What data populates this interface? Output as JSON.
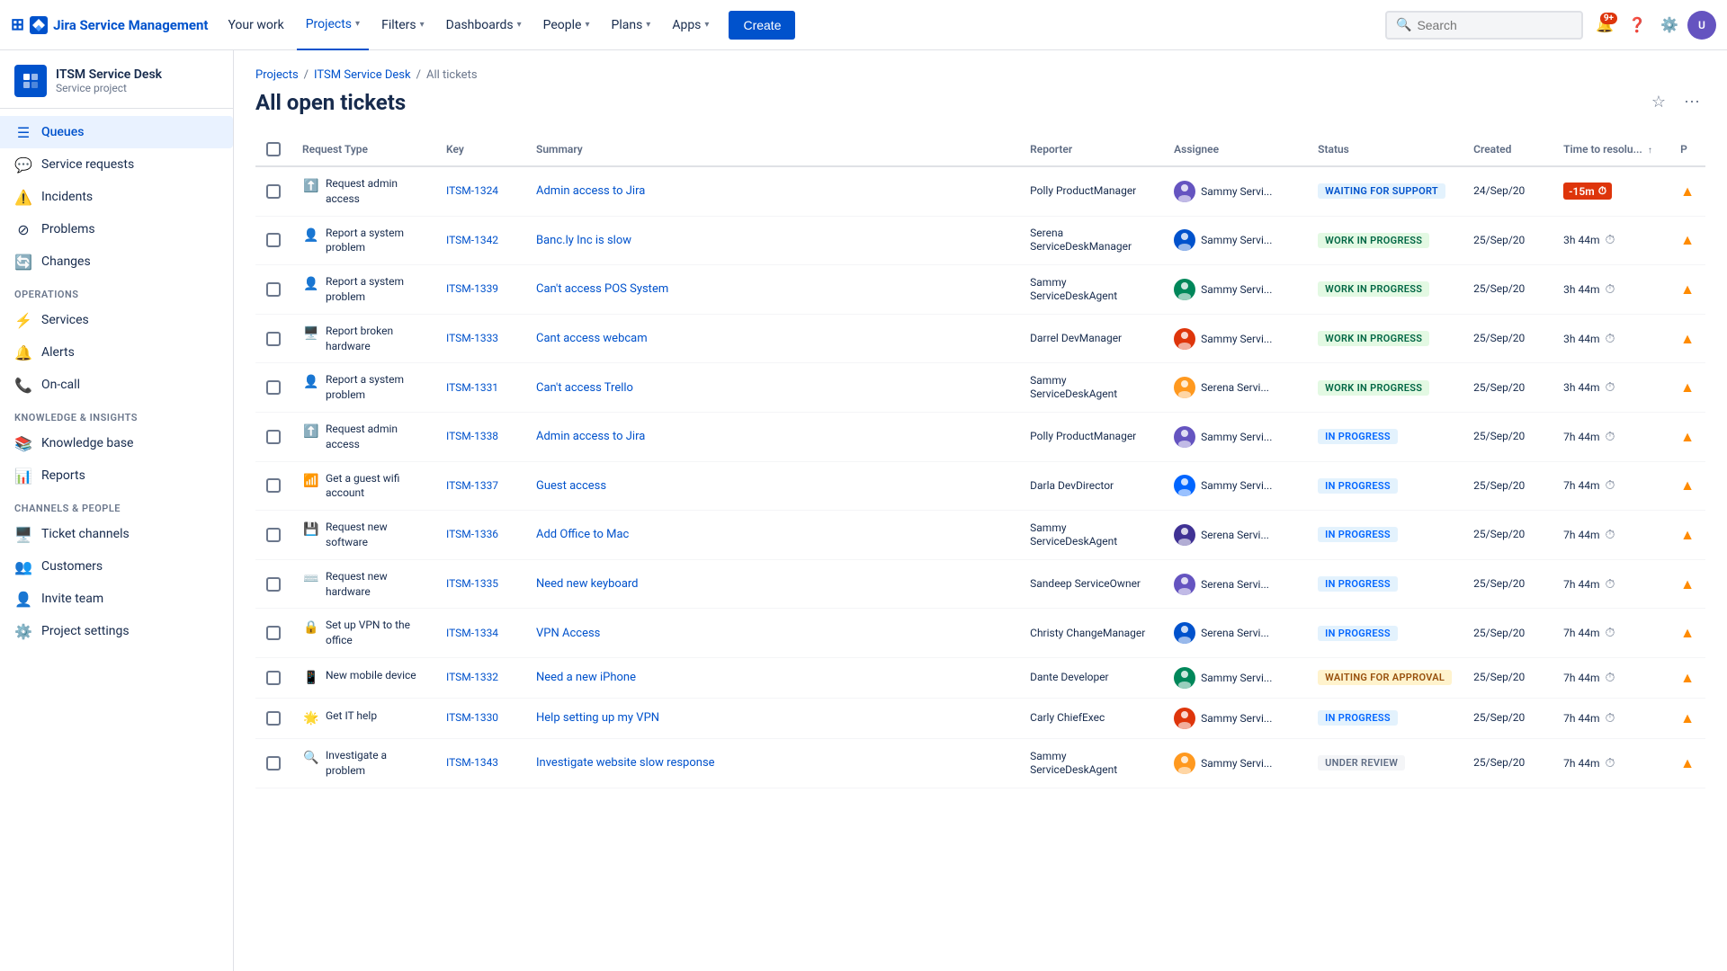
{
  "app": {
    "name": "Jira Service Management"
  },
  "topnav": {
    "your_work": "Your work",
    "projects": "Projects",
    "filters": "Filters",
    "dashboards": "Dashboards",
    "people": "People",
    "plans": "Plans",
    "apps": "Apps",
    "create_label": "Create",
    "search_placeholder": "Search",
    "notification_count": "9+"
  },
  "sidebar": {
    "project_name": "ITSM Service Desk",
    "project_type": "Service project",
    "queues_label": "Queues",
    "service_requests_label": "Service requests",
    "incidents_label": "Incidents",
    "problems_label": "Problems",
    "changes_label": "Changes",
    "operations_label": "OPERATIONS",
    "services_label": "Services",
    "alerts_label": "Alerts",
    "on_call_label": "On-call",
    "knowledge_insights_label": "KNOWLEDGE & INSIGHTS",
    "knowledge_base_label": "Knowledge base",
    "reports_label": "Reports",
    "channels_people_label": "CHANNELS & PEOPLE",
    "ticket_channels_label": "Ticket channels",
    "customers_label": "Customers",
    "invite_team_label": "Invite team",
    "project_settings_label": "Project settings"
  },
  "breadcrumb": {
    "projects": "Projects",
    "itsm": "ITSM Service Desk",
    "all_tickets": "All tickets"
  },
  "page": {
    "title": "All open tickets"
  },
  "table": {
    "col_request_type": "Request Type",
    "col_key": "Key",
    "col_summary": "Summary",
    "col_reporter": "Reporter",
    "col_assignee": "Assignee",
    "col_status": "Status",
    "col_created": "Created",
    "col_time": "Time to resolu...",
    "col_priority": "P"
  },
  "tickets": [
    {
      "req_icon": "⬆️",
      "req_type": "Request admin access",
      "key": "ITSM-1324",
      "summary": "Admin access to Jira",
      "reporter": "Polly ProductManager",
      "assignee": "Sammy Servi...",
      "status": "WAITING FOR SUPPORT",
      "status_class": "status-waiting",
      "created": "24/Sep/20",
      "time": "-15m",
      "time_overdue": true,
      "priority_up": true
    },
    {
      "req_icon": "👤",
      "req_type": "Report a system problem",
      "key": "ITSM-1342",
      "summary": "Banc.ly Inc is slow",
      "reporter": "Serena ServiceDeskManager",
      "assignee": "Sammy Servi...",
      "status": "WORK IN PROGRESS",
      "status_class": "status-wip",
      "created": "25/Sep/20",
      "time": "3h 44m",
      "time_overdue": false,
      "priority_up": true
    },
    {
      "req_icon": "👤",
      "req_type": "Report a system problem",
      "key": "ITSM-1339",
      "summary": "Can't access POS System",
      "reporter": "Sammy ServiceDeskAgent",
      "assignee": "Sammy Servi...",
      "status": "WORK IN PROGRESS",
      "status_class": "status-wip",
      "created": "25/Sep/20",
      "time": "3h 44m",
      "time_overdue": false,
      "priority_up": true
    },
    {
      "req_icon": "🖥️",
      "req_type": "Report broken hardware",
      "key": "ITSM-1333",
      "summary": "Cant access webcam",
      "reporter": "Darrel DevManager",
      "assignee": "Sammy Servi...",
      "status": "WORK IN PROGRESS",
      "status_class": "status-wip",
      "created": "25/Sep/20",
      "time": "3h 44m",
      "time_overdue": false,
      "priority_up": true
    },
    {
      "req_icon": "👤",
      "req_type": "Report a system problem",
      "key": "ITSM-1331",
      "summary": "Can't access Trello",
      "reporter": "Sammy ServiceDeskAgent",
      "assignee": "Serena Servi...",
      "status": "WORK IN PROGRESS",
      "status_class": "status-wip",
      "created": "25/Sep/20",
      "time": "3h 44m",
      "time_overdue": false,
      "priority_up": true
    },
    {
      "req_icon": "⬆️",
      "req_type": "Request admin access",
      "key": "ITSM-1338",
      "summary": "Admin access to Jira",
      "reporter": "Polly ProductManager",
      "assignee": "Sammy Servi...",
      "status": "IN PROGRESS",
      "status_class": "status-in-progress",
      "created": "25/Sep/20",
      "time": "7h 44m",
      "time_overdue": false,
      "priority_up": true
    },
    {
      "req_icon": "📶",
      "req_type": "Get a guest wifi account",
      "key": "ITSM-1337",
      "summary": "Guest access",
      "reporter": "Darla DevDirector",
      "assignee": "Sammy Servi...",
      "status": "IN PROGRESS",
      "status_class": "status-in-progress",
      "created": "25/Sep/20",
      "time": "7h 44m",
      "time_overdue": false,
      "priority_up": true
    },
    {
      "req_icon": "💾",
      "req_type": "Request new software",
      "key": "ITSM-1336",
      "summary": "Add Office to Mac",
      "reporter": "Sammy ServiceDeskAgent",
      "assignee": "Serena Servi...",
      "status": "IN PROGRESS",
      "status_class": "status-in-progress",
      "created": "25/Sep/20",
      "time": "7h 44m",
      "time_overdue": false,
      "priority_up": true
    },
    {
      "req_icon": "⌨️",
      "req_type": "Request new hardware",
      "key": "ITSM-1335",
      "summary": "Need new keyboard",
      "reporter": "Sandeep ServiceOwner",
      "assignee": "Serena Servi...",
      "status": "IN PROGRESS",
      "status_class": "status-in-progress",
      "created": "25/Sep/20",
      "time": "7h 44m",
      "time_overdue": false,
      "priority_up": true
    },
    {
      "req_icon": "🔒",
      "req_type": "Set up VPN to the office",
      "key": "ITSM-1334",
      "summary": "VPN Access",
      "reporter": "Christy ChangeManager",
      "assignee": "Serena Servi...",
      "status": "IN PROGRESS",
      "status_class": "status-in-progress",
      "created": "25/Sep/20",
      "time": "7h 44m",
      "time_overdue": false,
      "priority_up": true
    },
    {
      "req_icon": "📱",
      "req_type": "New mobile device",
      "key": "ITSM-1332",
      "summary": "Need a new iPhone",
      "reporter": "Dante Developer",
      "assignee": "Sammy Servi...",
      "status": "WAITING FOR APPROVAL",
      "status_class": "status-waiting-approval",
      "created": "25/Sep/20",
      "time": "7h 44m",
      "time_overdue": false,
      "priority_up": true
    },
    {
      "req_icon": "🌟",
      "req_type": "Get IT help",
      "key": "ITSM-1330",
      "summary": "Help setting up my VPN",
      "reporter": "Carly ChiefExec",
      "assignee": "Sammy Servi...",
      "status": "IN PROGRESS",
      "status_class": "status-in-progress",
      "created": "25/Sep/20",
      "time": "7h 44m",
      "time_overdue": false,
      "priority_up": true
    },
    {
      "req_icon": "🔍",
      "req_type": "Investigate a problem",
      "key": "ITSM-1343",
      "summary": "Investigate website slow response",
      "reporter": "Sammy ServiceDeskAgent",
      "assignee": "Sammy Servi...",
      "status": "UNDER REVIEW",
      "status_class": "status-under-review",
      "created": "25/Sep/20",
      "time": "7h 44m",
      "time_overdue": false,
      "priority_up": true
    }
  ]
}
